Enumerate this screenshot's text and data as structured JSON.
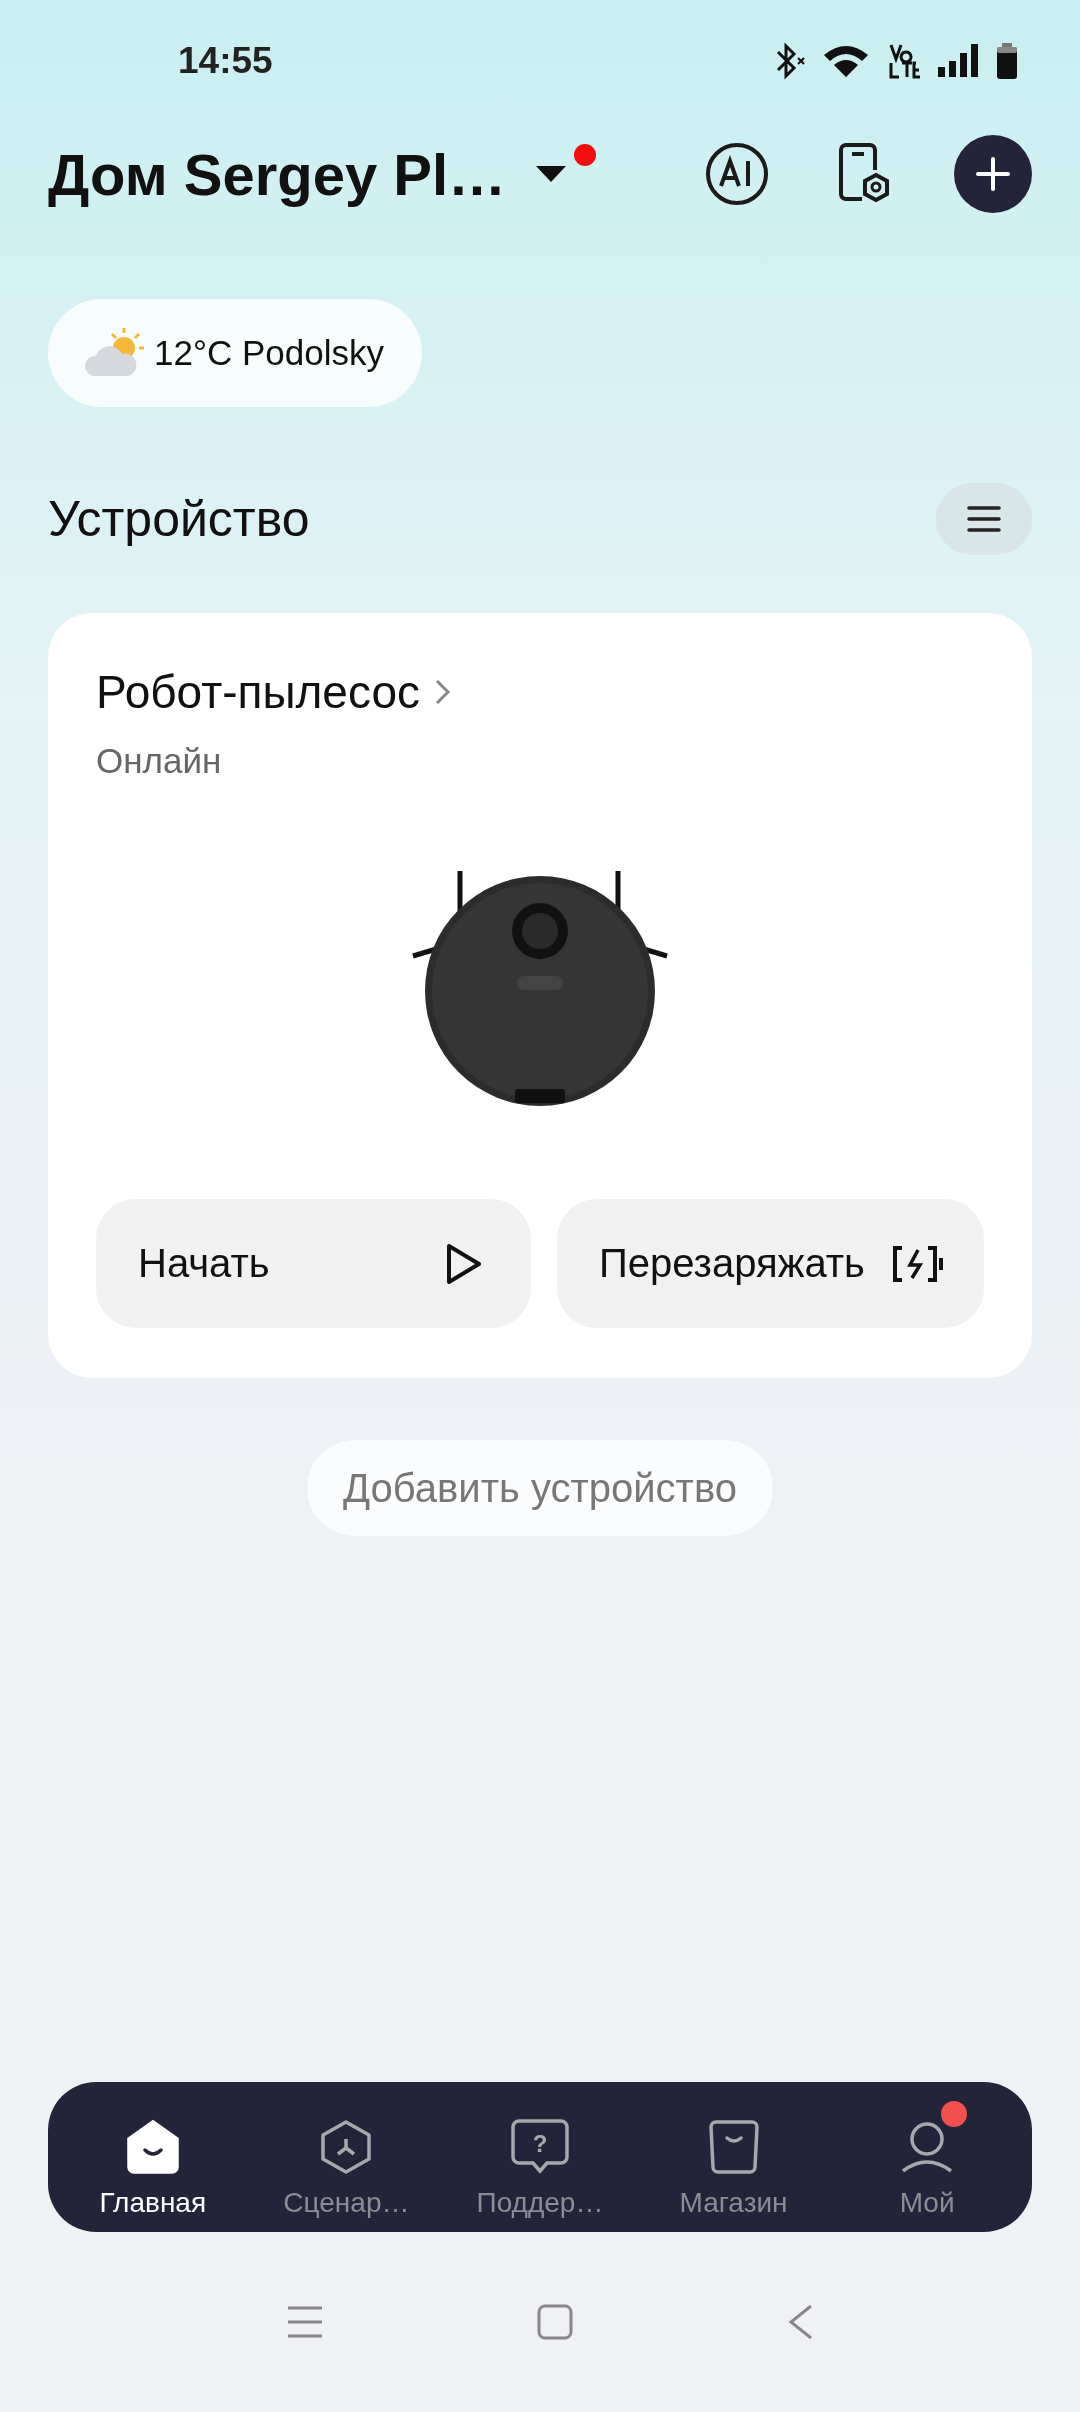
{
  "status_bar": {
    "time": "14:55"
  },
  "header": {
    "title": "Дом Sergey Pl…",
    "has_notification": true
  },
  "weather": {
    "text": "12°C Podolsky"
  },
  "section": {
    "title": "Устройство"
  },
  "device_card": {
    "name": "Робот-пылесос",
    "status": "Онлайн",
    "actions": [
      {
        "label": "Начать",
        "kind": "play"
      },
      {
        "label": "Перезаряжать",
        "kind": "charge"
      }
    ]
  },
  "add_device": {
    "label": "Добавить устройство"
  },
  "tabs": [
    {
      "label": "Главная",
      "kind": "home",
      "selected": true,
      "badge": false
    },
    {
      "label": "Сценар…",
      "kind": "scene",
      "selected": false,
      "badge": false
    },
    {
      "label": "Поддер…",
      "kind": "support",
      "glyph": "?",
      "selected": false,
      "badge": false
    },
    {
      "label": "Магазин",
      "kind": "shop",
      "selected": false,
      "badge": false
    },
    {
      "label": "Мой",
      "kind": "profile",
      "selected": false,
      "badge": true
    }
  ]
}
